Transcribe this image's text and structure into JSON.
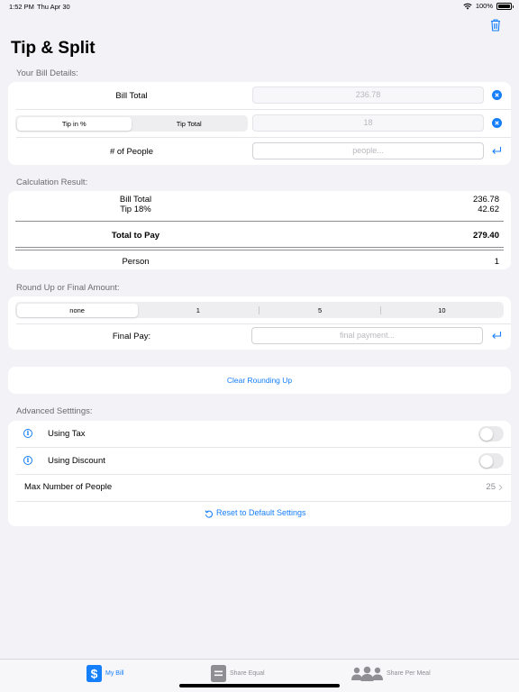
{
  "status_bar": {
    "time": "1:52 PM",
    "date": "Thu Apr 30",
    "battery": "100%"
  },
  "header": {
    "title": "Tip & Split",
    "trash_icon": "trash-icon"
  },
  "bill_details": {
    "section_title": "Your Bill Details:",
    "bill_total_label": "Bill Total",
    "bill_total_value": "236.78",
    "tip_mode_options": [
      "Tip in %",
      "Tip Total"
    ],
    "tip_mode_selected": "Tip in %",
    "tip_value": "18",
    "people_label": "# of People",
    "people_placeholder": "people..."
  },
  "calculation": {
    "section_title": "Calculation Result:",
    "bill_total_label": "Bill Total",
    "bill_total_value": "236.78",
    "tip_label": "Tip 18%",
    "tip_value": "42.62",
    "total_label": "Total to Pay",
    "total_value": "279.40",
    "person_label": "Person",
    "person_value": "1"
  },
  "round_up": {
    "section_title": "Round Up or Final Amount:",
    "options": [
      "none",
      "1",
      "5",
      "10"
    ],
    "selected": "none",
    "final_pay_label": "Final Pay:",
    "final_pay_placeholder": "final payment..."
  },
  "clear_rounding_label": "Clear Rounding Up",
  "advanced": {
    "section_title": "Advanced Setttings:",
    "using_tax_label": "Using Tax",
    "using_tax_on": false,
    "using_discount_label": "Using Discount",
    "using_discount_on": false,
    "max_people_label": "Max Number of People",
    "max_people_value": "25",
    "reset_label": "Reset to Default Settings"
  },
  "tabs": [
    {
      "label": "My Bill",
      "icon": "dollar-icon",
      "active": true
    },
    {
      "label": "Share Equal",
      "icon": "equal-icon",
      "active": false
    },
    {
      "label": "Share Per Meal",
      "icon": "people-group-icon",
      "active": false
    }
  ],
  "colors": {
    "accent": "#147efb",
    "background": "#f2f2f7",
    "card": "#ffffff",
    "secondary_text": "#6c6c70"
  }
}
